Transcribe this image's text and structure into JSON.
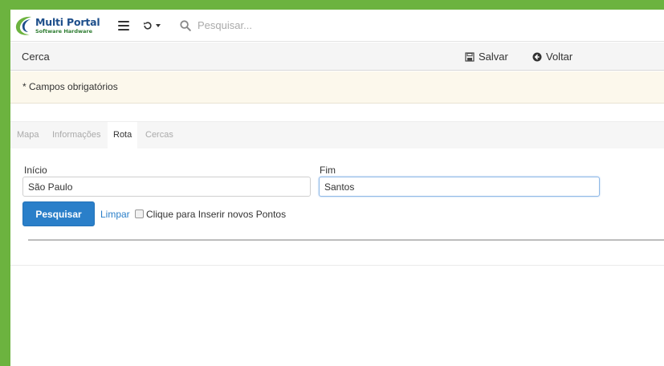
{
  "brand": {
    "name": "Multi Portal",
    "tagline": "Software Hardware",
    "green": "#6cb33f",
    "blue": "#1e4f8b"
  },
  "topbar": {
    "menu_icon": "hamburger-icon",
    "history_icon": "history-icon",
    "search_icon": "search-icon",
    "search_placeholder": "Pesquisar..."
  },
  "actionbar": {
    "title": "Cerca",
    "save_label": "Salvar",
    "back_label": "Voltar"
  },
  "notice": {
    "text": "* Campos obrigatórios"
  },
  "tabs": [
    {
      "label": "Mapa",
      "active": false
    },
    {
      "label": "Informações",
      "active": false
    },
    {
      "label": "Rota",
      "active": true
    },
    {
      "label": "Cercas",
      "active": false
    }
  ],
  "form": {
    "start_label": "Início",
    "start_value": "São Paulo",
    "end_label": "Fim",
    "end_value": "Santos",
    "search_button": "Pesquisar",
    "clear_link": "Limpar",
    "checkbox_label": "Clique para Inserir novos Pontos",
    "checkbox_checked": false
  }
}
